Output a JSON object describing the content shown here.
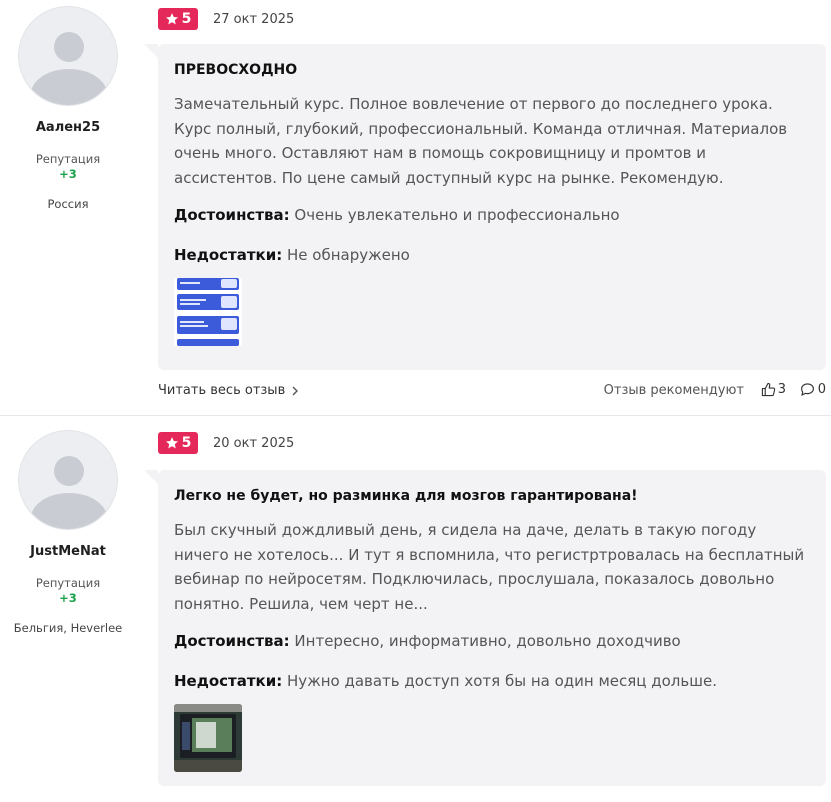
{
  "reviews": [
    {
      "author": {
        "name": "Аален25",
        "reputation_label": "Репутация",
        "reputation_value": "+3",
        "location": "Россия"
      },
      "rating": "5",
      "date": "27 окт 2025",
      "title": "ПРЕВОСХОДНО",
      "text": "Замечательный курс. Полное вовлечение от первого до последнего урока. Курс полный, глубокий, профессиональный. Команда отличная. Материалов очень много. Оставляют нам в помощь сокровищницу и промтов и ассистентов. По цене самый доступный курс на рынке. Рекомендую.",
      "pros_label": "Достоинства:",
      "pros": "Очень увлекательно и профессионально",
      "cons_label": "Недостатки:",
      "cons": "Не обнаружено",
      "read_more": "Читать весь отзыв",
      "recommend": "Отзыв рекомендуют",
      "likes": "3",
      "comments": "0"
    },
    {
      "author": {
        "name": "JustMeNat",
        "reputation_label": "Репутация",
        "reputation_value": "+3",
        "location": "Бельгия, Heverlee"
      },
      "rating": "5",
      "date": "20 окт 2025",
      "title": "Легко не будет, но разминка для мозгов гарантирована!",
      "text": "Был скучный дождливый день, я сидела на даче, делать в такую погоду ничего не хотелось... И тут я вспомнила, что регистртровалась на бесплатный вебинар по нейросетям. Подключилась, прослушала, показалось довольно понятно. Решила, чем черт не...",
      "pros_label": "Достоинства:",
      "pros": "Интересно, информативно, довольно доходчиво",
      "cons_label": "Недостатки:",
      "cons": "Нужно давать доступ хотя бы на один месяц дольше."
    }
  ],
  "icons": {
    "rating": "star-icon",
    "read_more": "chevron-right-icon",
    "likes": "thumbs-up-icon",
    "comments": "comment-icon"
  },
  "colors": {
    "rating_badge": "#e5285a",
    "reputation": "#1aa349",
    "card_bg": "#f3f3f6"
  }
}
